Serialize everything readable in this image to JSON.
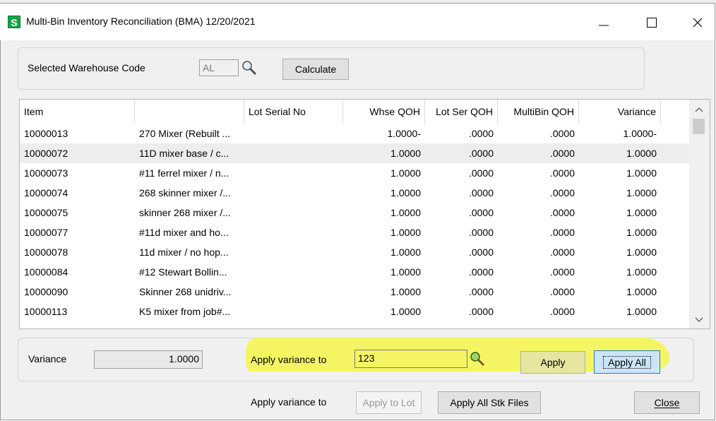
{
  "window": {
    "title": "Multi-Bin Inventory Reconciliation (BMA) 12/20/2021",
    "app_icon_letter": "S",
    "controls": [
      "minimize",
      "maximize",
      "close"
    ]
  },
  "top_panel": {
    "warehouse_label": "Selected Warehouse Code",
    "warehouse_value": "AL",
    "calculate_label": "Calculate"
  },
  "grid": {
    "columns": [
      "Item",
      "",
      "Lot Serial No",
      "Whse QOH",
      "Lot Ser QOH",
      "MultiBin QOH",
      "Variance"
    ],
    "rows": [
      {
        "item": "10000013",
        "desc": "270 Mixer (Rebuilt ...",
        "lot": "",
        "whse": "1.0000-",
        "lotser": ".0000",
        "multibin": ".0000",
        "variance": "1.0000-"
      },
      {
        "item": "10000072",
        "desc": "11D mixer base / c...",
        "lot": "",
        "whse": "1.0000",
        "lotser": ".0000",
        "multibin": ".0000",
        "variance": "1.0000"
      },
      {
        "item": "10000073",
        "desc": "#11 ferrel mixer / n...",
        "lot": "",
        "whse": "1.0000",
        "lotser": ".0000",
        "multibin": ".0000",
        "variance": "1.0000"
      },
      {
        "item": "10000074",
        "desc": "268 skinner mixer /...",
        "lot": "",
        "whse": "1.0000",
        "lotser": ".0000",
        "multibin": ".0000",
        "variance": "1.0000"
      },
      {
        "item": "10000075",
        "desc": "skinner 268 mixer /...",
        "lot": "",
        "whse": "1.0000",
        "lotser": ".0000",
        "multibin": ".0000",
        "variance": "1.0000"
      },
      {
        "item": "10000077",
        "desc": "#11d mixer and ho...",
        "lot": "",
        "whse": "1.0000",
        "lotser": ".0000",
        "multibin": ".0000",
        "variance": "1.0000"
      },
      {
        "item": "10000078",
        "desc": "11d mixer / no hop...",
        "lot": "",
        "whse": "1.0000",
        "lotser": ".0000",
        "multibin": ".0000",
        "variance": "1.0000"
      },
      {
        "item": "10000084",
        "desc": "#12 Stewart Bollin...",
        "lot": "",
        "whse": "1.0000",
        "lotser": ".0000",
        "multibin": ".0000",
        "variance": "1.0000"
      },
      {
        "item": "10000090",
        "desc": "Skinner 268 unidriv...",
        "lot": "",
        "whse": "1.0000",
        "lotser": ".0000",
        "multibin": ".0000",
        "variance": "1.0000"
      },
      {
        "item": "10000113",
        "desc": "K5 mixer from job#...",
        "lot": "",
        "whse": "1.0000",
        "lotser": ".0000",
        "multibin": ".0000",
        "variance": "1.0000"
      }
    ],
    "selected_row_index": 1
  },
  "bottom_panel": {
    "variance_label": "Variance",
    "variance_value": "1.0000",
    "apply_variance_label": "Apply variance to",
    "apply_variance_value": "123",
    "apply_label": "Apply",
    "apply_all_label": "Apply All"
  },
  "footer": {
    "apply_variance_label": "Apply variance to",
    "apply_to_lot_label": "Apply to Lot",
    "apply_all_stk_label": "Apply All Stk Files",
    "close_label": "Close"
  },
  "colors": {
    "highlight": "#f6f64a",
    "app_icon": "#11a54a",
    "selected_row": "#ededed"
  },
  "icons": [
    "magnifier-icon",
    "lookup-icon-green",
    "scroll-up-icon",
    "scroll-down-icon"
  ]
}
